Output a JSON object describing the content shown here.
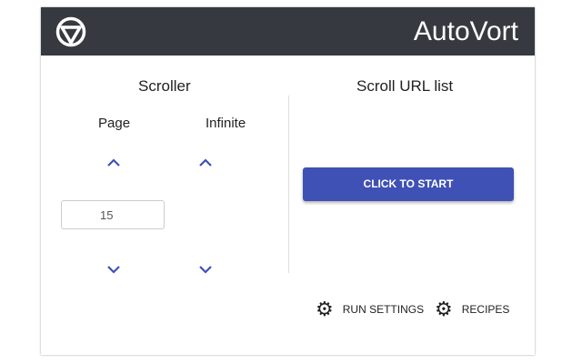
{
  "header": {
    "title": "AutoVort",
    "logo_icon": "vortex-logo-icon"
  },
  "scroller": {
    "heading": "Scroller",
    "page_label": "Page",
    "infinite_label": "Infinite",
    "page_value": "15"
  },
  "url_list": {
    "heading": "Scroll URL list",
    "start_label": "CLICK TO START"
  },
  "footer": {
    "run_settings": "RUN SETTINGS",
    "recipes": "RECIPES"
  },
  "colors": {
    "accent": "#3f51b5",
    "header_bg": "#363a40"
  }
}
